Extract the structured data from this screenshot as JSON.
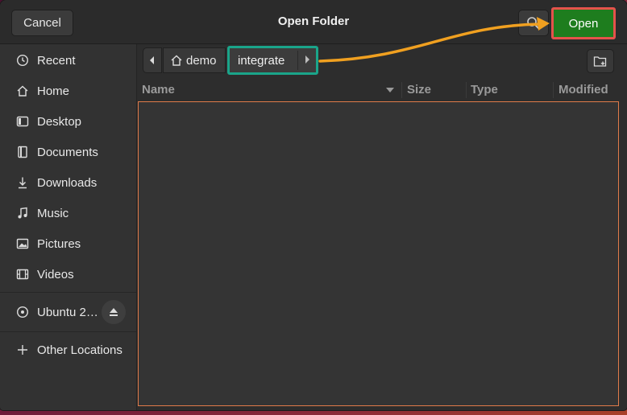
{
  "header": {
    "title": "Open Folder",
    "cancel_label": "Cancel",
    "open_label": "Open"
  },
  "sidebar": {
    "items": [
      {
        "label": "Recent",
        "icon": "clock-icon"
      },
      {
        "label": "Home",
        "icon": "home-icon"
      },
      {
        "label": "Desktop",
        "icon": "desktop-icon"
      },
      {
        "label": "Documents",
        "icon": "document-icon"
      },
      {
        "label": "Downloads",
        "icon": "download-icon"
      },
      {
        "label": "Music",
        "icon": "music-icon"
      },
      {
        "label": "Pictures",
        "icon": "picture-icon"
      },
      {
        "label": "Videos",
        "icon": "video-icon"
      }
    ],
    "device": {
      "label": "Ubuntu 2…",
      "icon": "disc-icon"
    },
    "other": {
      "label": "Other Locations",
      "icon": "plus-icon"
    }
  },
  "pathbar": {
    "crumbs": [
      "demo",
      "integrate"
    ]
  },
  "columns": {
    "name": "Name",
    "size": "Size",
    "type": "Type",
    "modified": "Modified"
  },
  "colors": {
    "open_button": "#1e7d1e",
    "open_highlight": "#e5534b",
    "crumb_highlight": "#1aa58a",
    "annotation_arrow": "#f0a020",
    "file_area_border": "#e07b4a"
  }
}
